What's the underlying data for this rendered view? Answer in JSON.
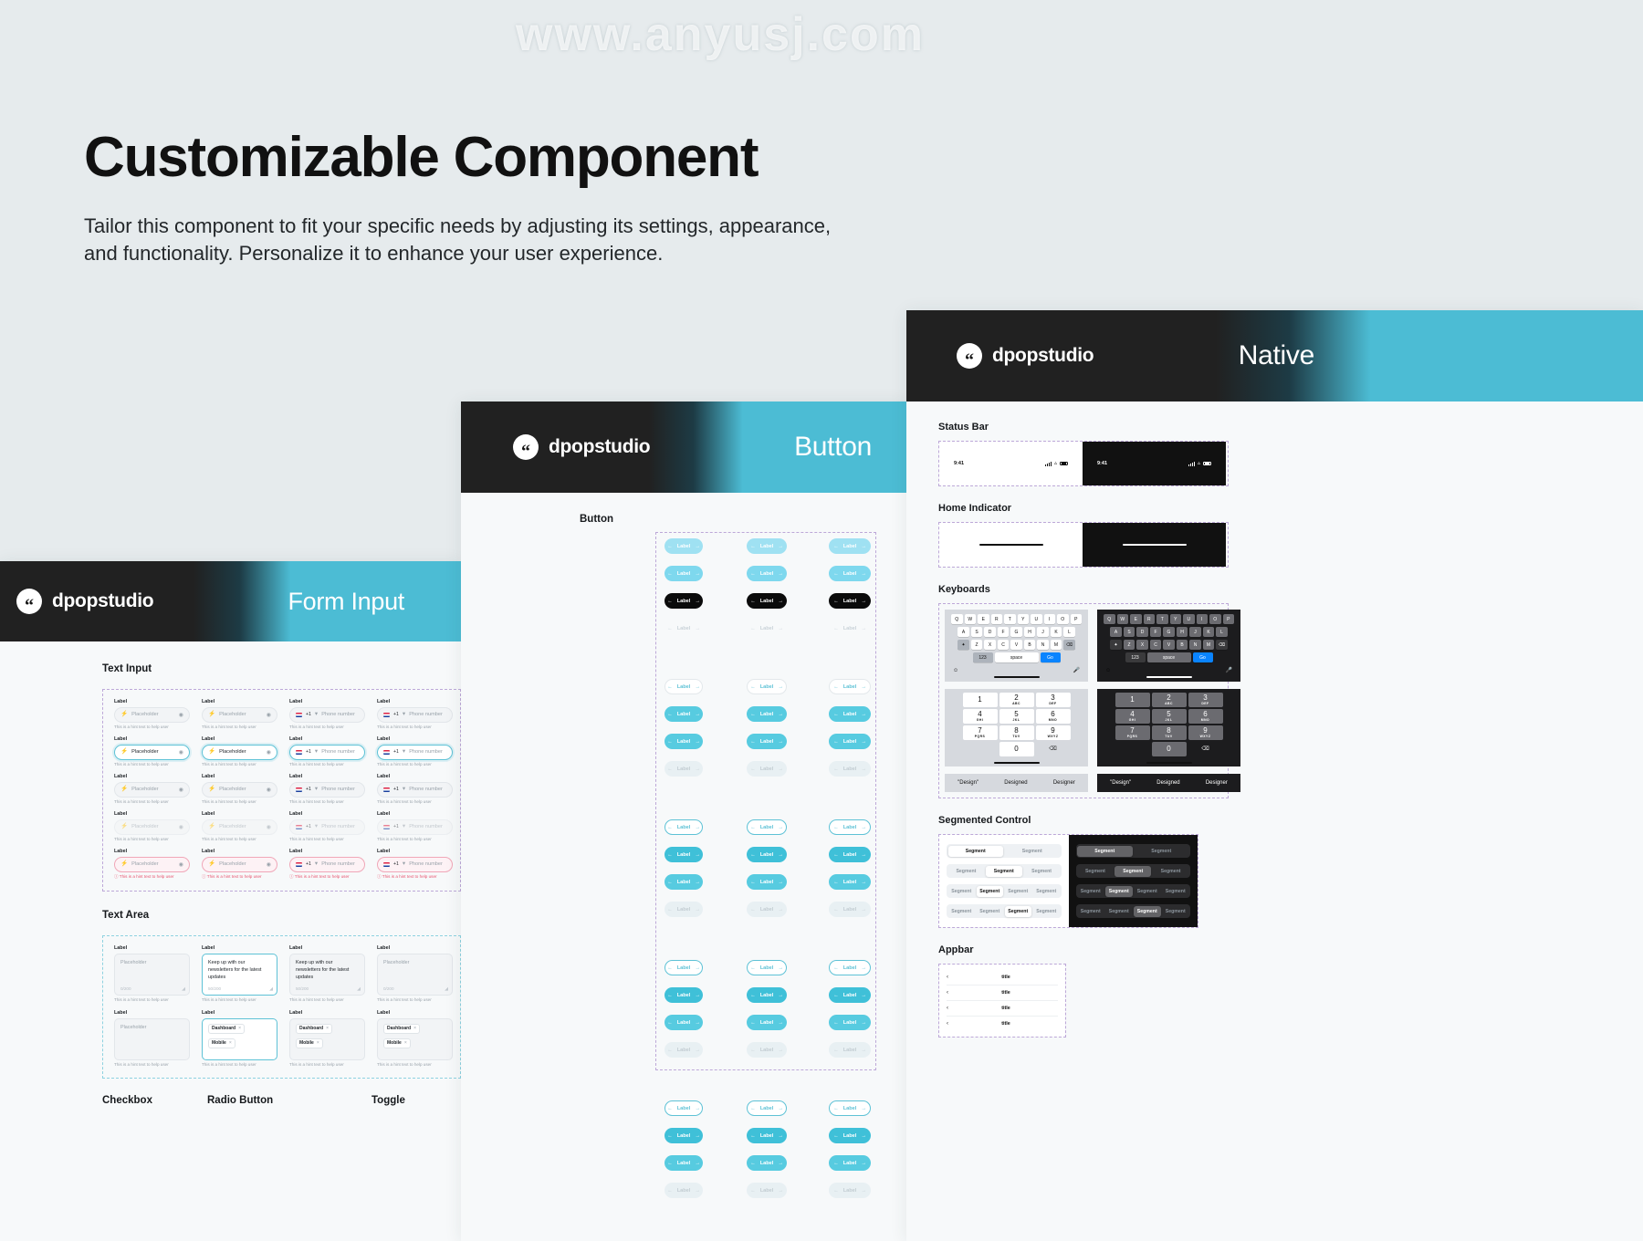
{
  "watermarks": [
    "www.anyusj.com",
    "www.anyusj.com",
    "www.anyusj.com",
    "www.anyusj.com"
  ],
  "hero": {
    "title": "Customizable Component",
    "subtitle": "Tailor this component to fit your specific needs by adjusting its settings, appearance, and functionality. Personalize it to enhance your user experience."
  },
  "brand": {
    "name": "dpopstudio",
    "mark": "quote-icon"
  },
  "cards": {
    "form_input": {
      "title": "Form Input",
      "sections": {
        "text_input": "Text Input",
        "text_area": "Text Area"
      },
      "field": {
        "label": "Label",
        "placeholder": "Placeholder",
        "hint": "This is a hint text to help user",
        "phone_placeholder": "Phone number",
        "country_code": "+1"
      },
      "textarea": {
        "placeholder": "Placeholder",
        "value": "Keep up with our newsletters for the latest updates",
        "counter_empty": "0/200",
        "counter_filled": "50/200",
        "hint": "This is a hint text to help user"
      },
      "tags": [
        "Dashboard",
        "Mobile"
      ],
      "bottom_sections": [
        "Checkbox",
        "Radio Button",
        "Toggle"
      ]
    },
    "button": {
      "title": "Button",
      "section": "Button",
      "label": "Label",
      "arrow_left": "←",
      "arrow_right": "→"
    },
    "native": {
      "title": "Native",
      "sections": {
        "status_bar": "Status Bar",
        "home_indicator": "Home Indicator",
        "keyboards": "Keyboards",
        "segmented_control": "Segmented Control",
        "appbar": "Appbar"
      },
      "status_time": "9:41",
      "keyboard": {
        "row1": [
          "Q",
          "W",
          "E",
          "R",
          "T",
          "Y",
          "U",
          "I",
          "O",
          "P"
        ],
        "row2": [
          "A",
          "S",
          "D",
          "F",
          "G",
          "H",
          "J",
          "K",
          "L"
        ],
        "row3": [
          "✦",
          "Z",
          "X",
          "C",
          "V",
          "B",
          "N",
          "M",
          "⌫"
        ],
        "row4": [
          "123",
          "space",
          "Go"
        ],
        "numpad": [
          {
            "n": "1",
            "s": ""
          },
          {
            "n": "2",
            "s": "ABC"
          },
          {
            "n": "3",
            "s": "DEF"
          },
          {
            "n": "4",
            "s": "GHI"
          },
          {
            "n": "5",
            "s": "JKL"
          },
          {
            "n": "6",
            "s": "MNO"
          },
          {
            "n": "7",
            "s": "PQRS"
          },
          {
            "n": "8",
            "s": "TUV"
          },
          {
            "n": "9",
            "s": "WXYZ"
          },
          {
            "n": "0",
            "s": ""
          }
        ],
        "predictions": [
          "\"Design\"",
          "Designed",
          "Designer"
        ],
        "emoji_icon": "emoji-icon",
        "mic_icon": "microphone-icon",
        "delete_icon": "⌫"
      },
      "segment_label": "Segment",
      "appbar_title": "title"
    }
  },
  "colors": {
    "accent": "#4cbcd4",
    "dark": "#212121",
    "page_bg": "#e6ebed",
    "card_bg": "#f7f9fa",
    "error": "#e8536f"
  }
}
